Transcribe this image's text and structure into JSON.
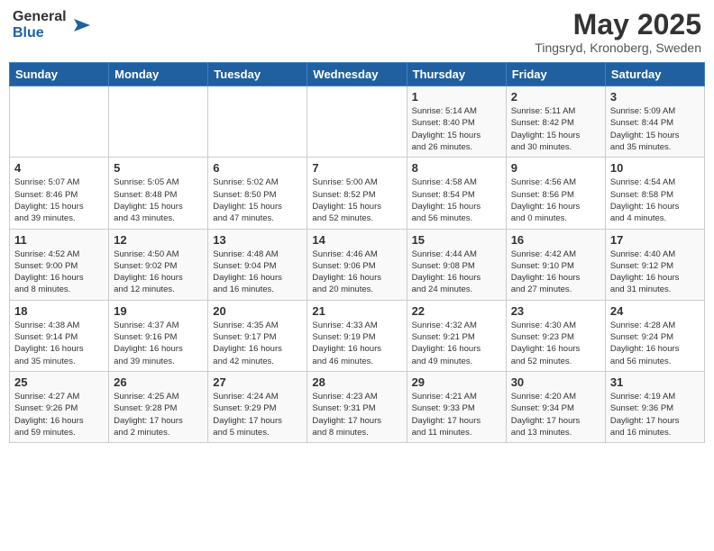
{
  "header": {
    "logo_general": "General",
    "logo_blue": "Blue",
    "title": "May 2025",
    "subtitle": "Tingsryd, Kronoberg, Sweden"
  },
  "weekdays": [
    "Sunday",
    "Monday",
    "Tuesday",
    "Wednesday",
    "Thursday",
    "Friday",
    "Saturday"
  ],
  "weeks": [
    [
      {
        "day": "",
        "info": ""
      },
      {
        "day": "",
        "info": ""
      },
      {
        "day": "",
        "info": ""
      },
      {
        "day": "",
        "info": ""
      },
      {
        "day": "1",
        "info": "Sunrise: 5:14 AM\nSunset: 8:40 PM\nDaylight: 15 hours\nand 26 minutes."
      },
      {
        "day": "2",
        "info": "Sunrise: 5:11 AM\nSunset: 8:42 PM\nDaylight: 15 hours\nand 30 minutes."
      },
      {
        "day": "3",
        "info": "Sunrise: 5:09 AM\nSunset: 8:44 PM\nDaylight: 15 hours\nand 35 minutes."
      }
    ],
    [
      {
        "day": "4",
        "info": "Sunrise: 5:07 AM\nSunset: 8:46 PM\nDaylight: 15 hours\nand 39 minutes."
      },
      {
        "day": "5",
        "info": "Sunrise: 5:05 AM\nSunset: 8:48 PM\nDaylight: 15 hours\nand 43 minutes."
      },
      {
        "day": "6",
        "info": "Sunrise: 5:02 AM\nSunset: 8:50 PM\nDaylight: 15 hours\nand 47 minutes."
      },
      {
        "day": "7",
        "info": "Sunrise: 5:00 AM\nSunset: 8:52 PM\nDaylight: 15 hours\nand 52 minutes."
      },
      {
        "day": "8",
        "info": "Sunrise: 4:58 AM\nSunset: 8:54 PM\nDaylight: 15 hours\nand 56 minutes."
      },
      {
        "day": "9",
        "info": "Sunrise: 4:56 AM\nSunset: 8:56 PM\nDaylight: 16 hours\nand 0 minutes."
      },
      {
        "day": "10",
        "info": "Sunrise: 4:54 AM\nSunset: 8:58 PM\nDaylight: 16 hours\nand 4 minutes."
      }
    ],
    [
      {
        "day": "11",
        "info": "Sunrise: 4:52 AM\nSunset: 9:00 PM\nDaylight: 16 hours\nand 8 minutes."
      },
      {
        "day": "12",
        "info": "Sunrise: 4:50 AM\nSunset: 9:02 PM\nDaylight: 16 hours\nand 12 minutes."
      },
      {
        "day": "13",
        "info": "Sunrise: 4:48 AM\nSunset: 9:04 PM\nDaylight: 16 hours\nand 16 minutes."
      },
      {
        "day": "14",
        "info": "Sunrise: 4:46 AM\nSunset: 9:06 PM\nDaylight: 16 hours\nand 20 minutes."
      },
      {
        "day": "15",
        "info": "Sunrise: 4:44 AM\nSunset: 9:08 PM\nDaylight: 16 hours\nand 24 minutes."
      },
      {
        "day": "16",
        "info": "Sunrise: 4:42 AM\nSunset: 9:10 PM\nDaylight: 16 hours\nand 27 minutes."
      },
      {
        "day": "17",
        "info": "Sunrise: 4:40 AM\nSunset: 9:12 PM\nDaylight: 16 hours\nand 31 minutes."
      }
    ],
    [
      {
        "day": "18",
        "info": "Sunrise: 4:38 AM\nSunset: 9:14 PM\nDaylight: 16 hours\nand 35 minutes."
      },
      {
        "day": "19",
        "info": "Sunrise: 4:37 AM\nSunset: 9:16 PM\nDaylight: 16 hours\nand 39 minutes."
      },
      {
        "day": "20",
        "info": "Sunrise: 4:35 AM\nSunset: 9:17 PM\nDaylight: 16 hours\nand 42 minutes."
      },
      {
        "day": "21",
        "info": "Sunrise: 4:33 AM\nSunset: 9:19 PM\nDaylight: 16 hours\nand 46 minutes."
      },
      {
        "day": "22",
        "info": "Sunrise: 4:32 AM\nSunset: 9:21 PM\nDaylight: 16 hours\nand 49 minutes."
      },
      {
        "day": "23",
        "info": "Sunrise: 4:30 AM\nSunset: 9:23 PM\nDaylight: 16 hours\nand 52 minutes."
      },
      {
        "day": "24",
        "info": "Sunrise: 4:28 AM\nSunset: 9:24 PM\nDaylight: 16 hours\nand 56 minutes."
      }
    ],
    [
      {
        "day": "25",
        "info": "Sunrise: 4:27 AM\nSunset: 9:26 PM\nDaylight: 16 hours\nand 59 minutes."
      },
      {
        "day": "26",
        "info": "Sunrise: 4:25 AM\nSunset: 9:28 PM\nDaylight: 17 hours\nand 2 minutes."
      },
      {
        "day": "27",
        "info": "Sunrise: 4:24 AM\nSunset: 9:29 PM\nDaylight: 17 hours\nand 5 minutes."
      },
      {
        "day": "28",
        "info": "Sunrise: 4:23 AM\nSunset: 9:31 PM\nDaylight: 17 hours\nand 8 minutes."
      },
      {
        "day": "29",
        "info": "Sunrise: 4:21 AM\nSunset: 9:33 PM\nDaylight: 17 hours\nand 11 minutes."
      },
      {
        "day": "30",
        "info": "Sunrise: 4:20 AM\nSunset: 9:34 PM\nDaylight: 17 hours\nand 13 minutes."
      },
      {
        "day": "31",
        "info": "Sunrise: 4:19 AM\nSunset: 9:36 PM\nDaylight: 17 hours\nand 16 minutes."
      }
    ]
  ]
}
